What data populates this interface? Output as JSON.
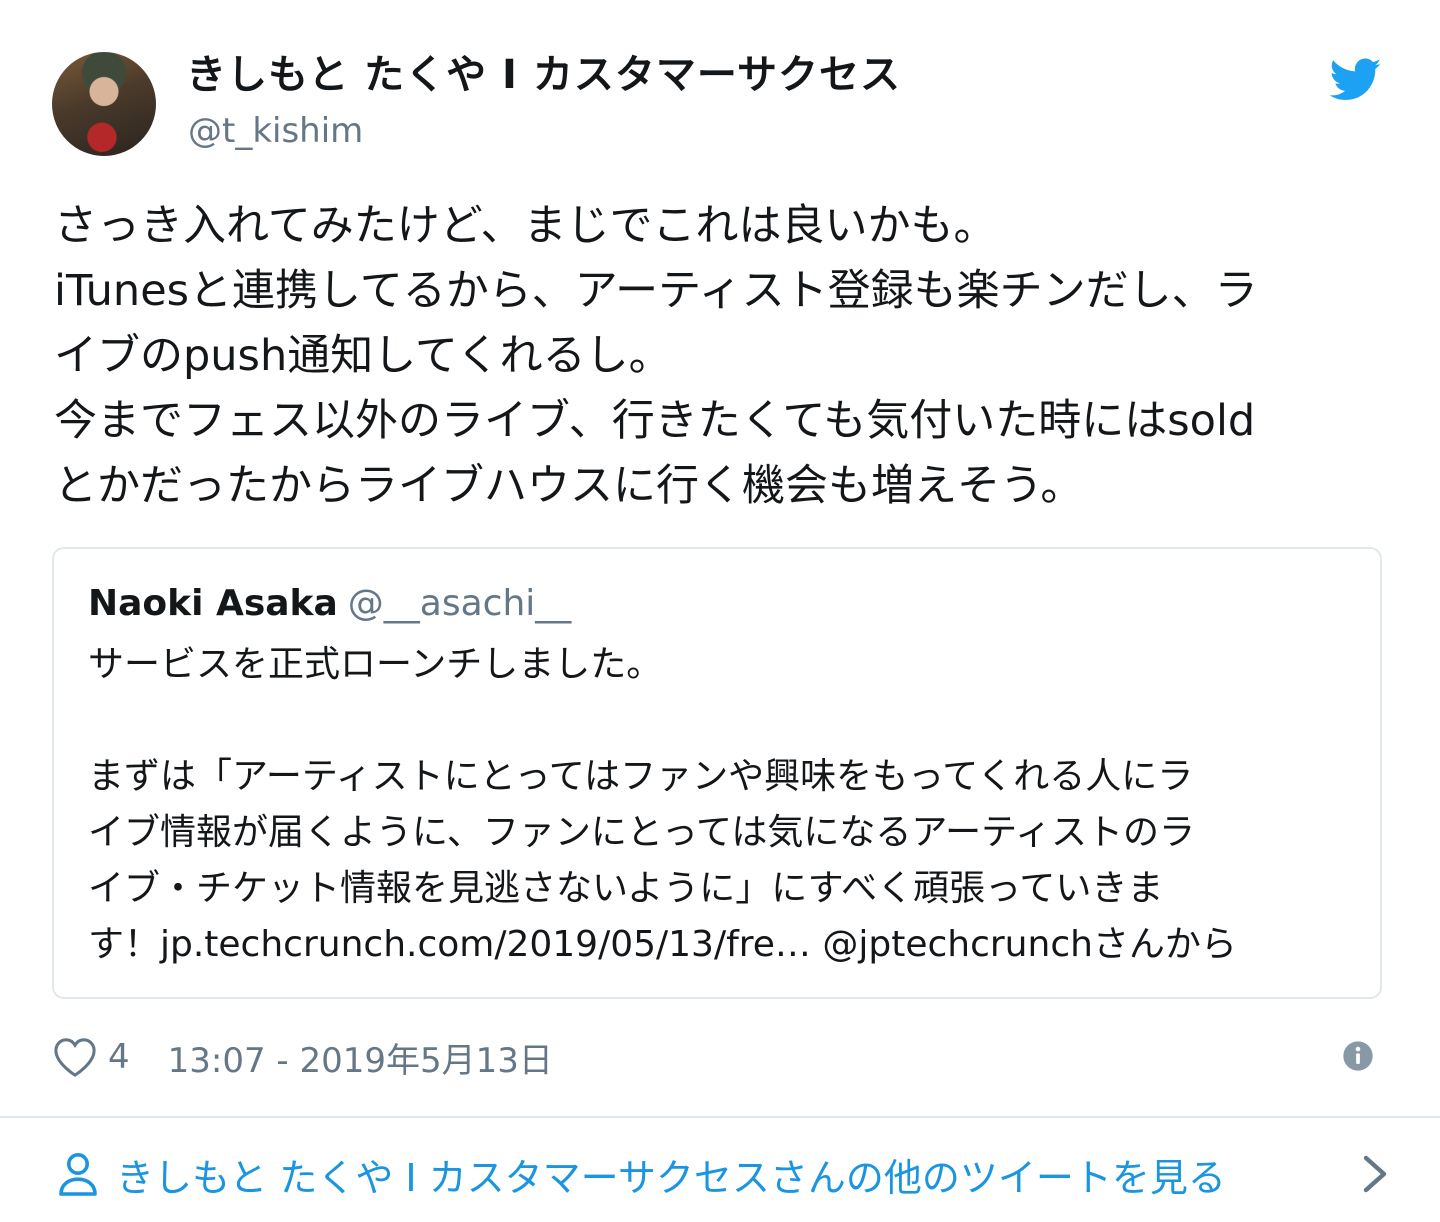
{
  "author": {
    "display_name": "きしもと たくや I カスタマーサクセス",
    "handle": "@t_kishim"
  },
  "tweet": {
    "lines": [
      "さっき入れてみたけど、まじでこれは良いかも。",
      "iTunesと連携してるから、アーティスト登録も楽チンだし、ラ",
      "イブのpush通知してくれるし。",
      "今までフェス以外のライブ、行きたくても気付いた時にはsold",
      "とかだったからライブハウスに行く機会も増えそう。"
    ]
  },
  "quoted": {
    "name": "Naoki Asaka",
    "handle": "@__asachi__",
    "lines": [
      "サービスを正式ローンチしました。",
      "",
      "まずは「アーティストにとってはファンや興味をもってくれる人にラ",
      "イブ情報が届くように、ファンにとっては気になるアーティストのラ",
      "イブ・チケット情報を見逃さないように」にすべく頑張っていきま",
      "す！jp.techcrunch.com/2019/05/13/fre… @jptechcrunchさんから"
    ]
  },
  "meta": {
    "like_count": "4",
    "timestamp": "13:07 - 2019年5月13日"
  },
  "footer": {
    "more_link": "きしもと たくや I カスタマーサクセスさんの他のツイートを見る"
  },
  "colors": {
    "twitter_blue": "#1da1f2",
    "link_blue": "#1b95e0",
    "secondary_text": "#657786",
    "border": "#e1e8ed"
  },
  "icons": [
    "twitter-bird-icon",
    "heart-icon",
    "info-icon",
    "person-icon",
    "chevron-right-icon"
  ]
}
